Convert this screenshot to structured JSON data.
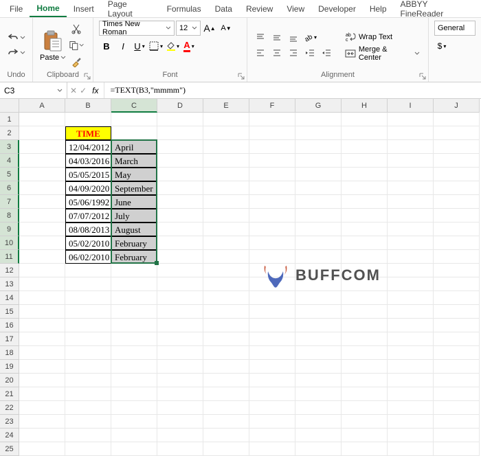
{
  "menubar": [
    "File",
    "Home",
    "Insert",
    "Page Layout",
    "Formulas",
    "Data",
    "Review",
    "View",
    "Developer",
    "Help",
    "ABBYY FineReader"
  ],
  "menubar_active_index": 1,
  "ribbon": {
    "undo": {
      "label": "Undo"
    },
    "clipboard": {
      "label": "Clipboard",
      "paste": "Paste"
    },
    "font": {
      "label": "Font",
      "name": "Times New Roman",
      "size": "12",
      "bold": "B",
      "italic": "I",
      "underline": "U"
    },
    "alignment": {
      "label": "Alignment",
      "wrap": "Wrap Text",
      "merge": "Merge & Center"
    },
    "number": {
      "format": "General",
      "currency": "$"
    }
  },
  "formula_bar": {
    "cell_ref": "C3",
    "formula": "=TEXT(B3,\"mmmm\")"
  },
  "columns": [
    "A",
    "B",
    "C",
    "D",
    "E",
    "F",
    "G",
    "H",
    "I",
    "J"
  ],
  "selected_col_index": 2,
  "row_count": 25,
  "selected_row_start": 3,
  "selected_row_end": 11,
  "data": {
    "B2": {
      "value": "TIME",
      "class": "time-header"
    },
    "B3": {
      "value": "12/04/2012",
      "class": "date"
    },
    "B4": {
      "value": "04/03/2016",
      "class": "date"
    },
    "B5": {
      "value": "05/05/2015",
      "class": "date"
    },
    "B6": {
      "value": "04/09/2020",
      "class": "date"
    },
    "B7": {
      "value": "05/06/1992",
      "class": "date"
    },
    "B8": {
      "value": "07/07/2012",
      "class": "date"
    },
    "B9": {
      "value": "08/08/2013",
      "class": "date"
    },
    "B10": {
      "value": "05/02/2010",
      "class": "date"
    },
    "B11": {
      "value": "06/02/2010",
      "class": "date"
    },
    "C3": {
      "value": "April",
      "class": "month"
    },
    "C4": {
      "value": "March",
      "class": "month"
    },
    "C5": {
      "value": "May",
      "class": "month"
    },
    "C6": {
      "value": "September",
      "class": "month"
    },
    "C7": {
      "value": "June",
      "class": "month"
    },
    "C8": {
      "value": "July",
      "class": "month"
    },
    "C9": {
      "value": "August",
      "class": "month"
    },
    "C10": {
      "value": "February",
      "class": "month"
    },
    "C11": {
      "value": "February",
      "class": "month"
    }
  },
  "watermark": "BUFFCOM"
}
